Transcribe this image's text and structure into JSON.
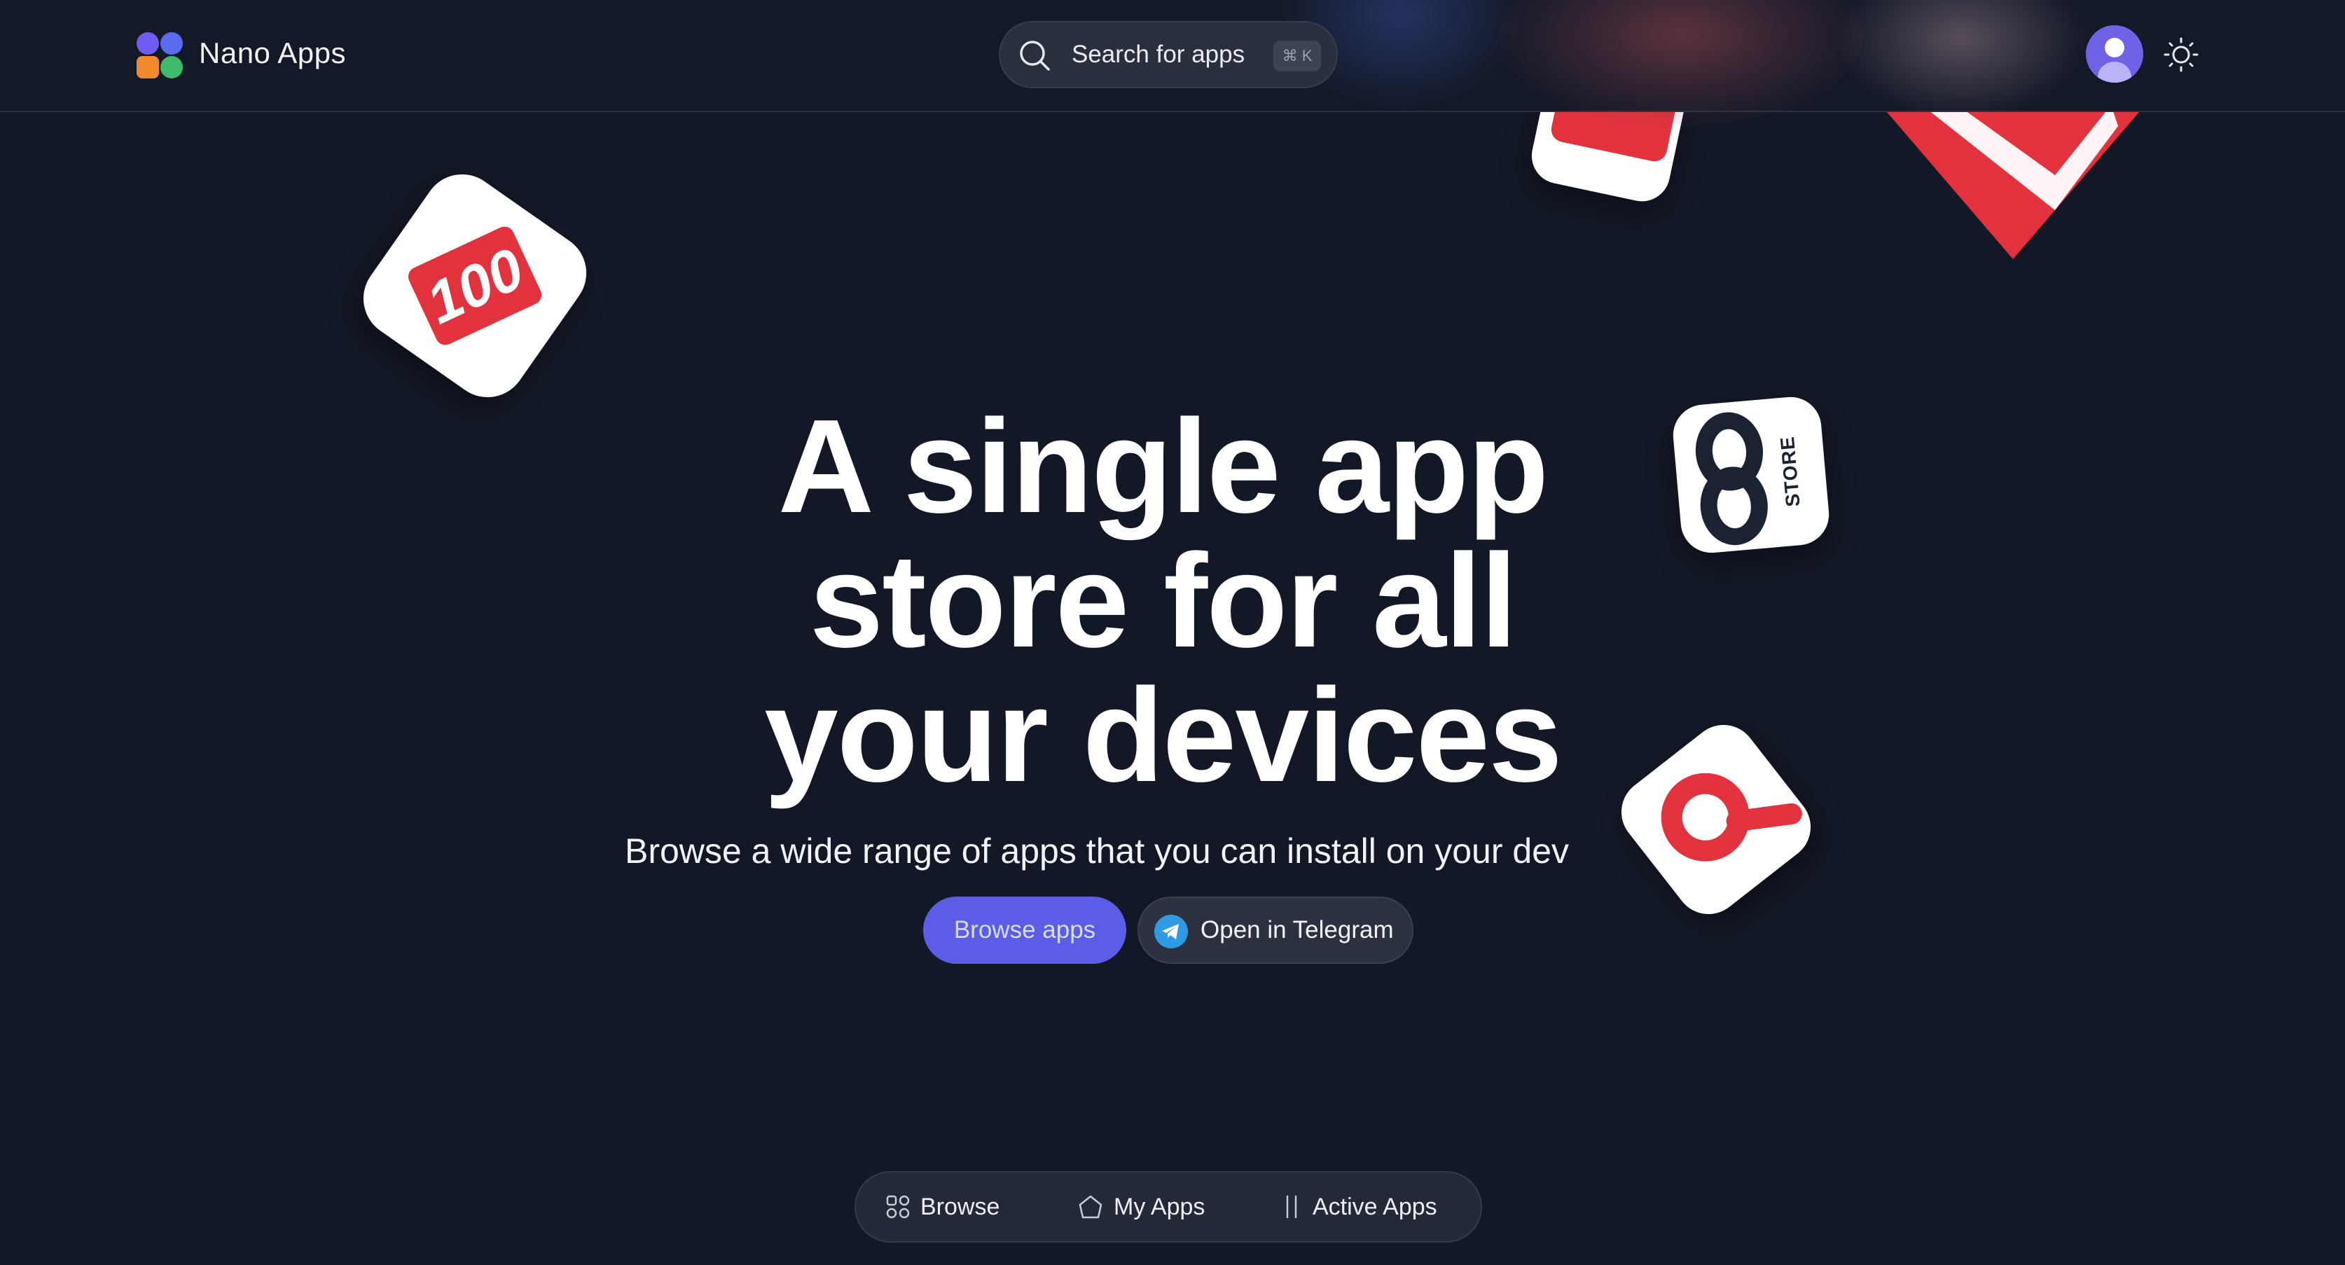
{
  "header": {
    "brand": "Nano Apps",
    "search": {
      "placeholder": "Search for apps",
      "shortcut": "⌘ K"
    },
    "icons": [
      "app-logo-icon",
      "search-icon",
      "user-avatar-icon",
      "sun-icon"
    ]
  },
  "hero": {
    "title_lines": [
      "A single app",
      "store for all",
      "your devices"
    ],
    "subtitle": "Browse a wide range of apps that you can install on your dev",
    "primary_button": "Browse apps",
    "secondary_button": "Open in Telegram"
  },
  "tiles": {
    "hundred": "100",
    "store": "STORE"
  },
  "bottom_nav": {
    "items": [
      {
        "label": "Browse",
        "icon": "grid-icon"
      },
      {
        "label": "My Apps",
        "icon": "home-icon"
      },
      {
        "label": "Active Apps",
        "icon": "columns-icon"
      }
    ]
  },
  "colors": {
    "background": "#131826",
    "accent": "#5b5de6",
    "tile_red": "#e2323d",
    "telegram": "#2f9be3"
  }
}
